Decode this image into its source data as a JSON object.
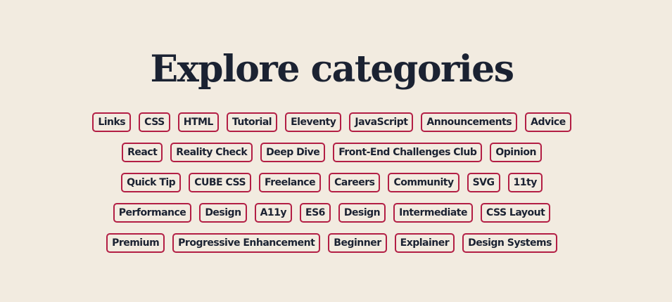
{
  "heading": "Explore categories",
  "accent_color": "#b31e44",
  "background_color": "#f2ebe0",
  "text_color": "#1b2232",
  "tag_rows": [
    [
      "Links",
      "CSS",
      "HTML",
      "Tutorial",
      "Eleventy",
      "JavaScript",
      "Announcements",
      "Advice"
    ],
    [
      "React",
      "Reality Check",
      "Deep Dive",
      "Front-End Challenges Club",
      "Opinion"
    ],
    [
      "Quick Tip",
      "CUBE CSS",
      "Freelance",
      "Careers",
      "Community",
      "SVG",
      "11ty"
    ],
    [
      "Performance",
      "Design",
      "A11y",
      "ES6",
      "Design",
      "Intermediate",
      "CSS Layout"
    ],
    [
      "Premium",
      "Progressive Enhancement",
      "Beginner",
      "Explainer",
      "Design Systems"
    ]
  ]
}
